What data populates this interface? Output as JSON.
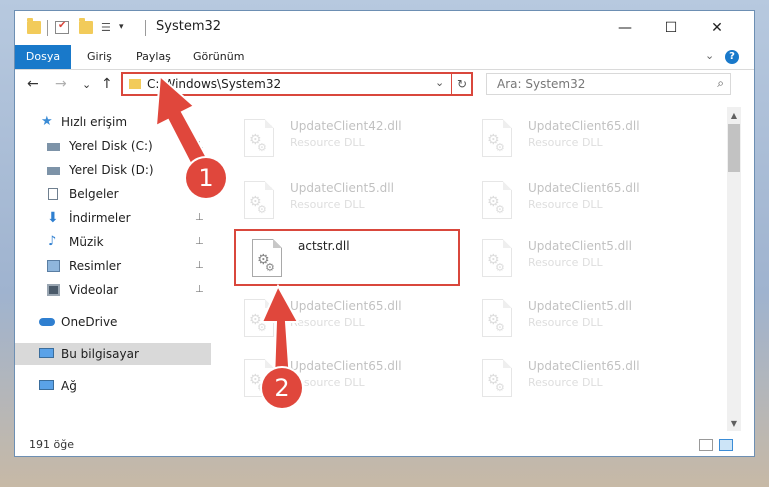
{
  "window": {
    "title": "System32",
    "controls": {
      "minimize": "—",
      "maximize": "☐",
      "close": "✕"
    }
  },
  "ribbon": {
    "tabs": [
      "Dosya",
      "Giriş",
      "Paylaş",
      "Görünüm"
    ],
    "expand_glyph": "⌄",
    "help_glyph": "?"
  },
  "nav": {
    "back": "←",
    "forward": "→",
    "recent": "⌄",
    "up": "↑",
    "address": "C:\\Windows\\System32",
    "address_drop": "⌄",
    "refresh": "↻",
    "search_placeholder": "Ara: System32",
    "search_glyph": "⌕"
  },
  "sidebar": {
    "items": [
      {
        "label": "Hızlı erişim",
        "icon": "star-icon"
      },
      {
        "label": "Yerel Disk (C:)",
        "icon": "drive-icon",
        "pinned": true
      },
      {
        "label": "Yerel Disk (D:)",
        "icon": "drive-icon"
      },
      {
        "label": "Belgeler",
        "icon": "documents-icon"
      },
      {
        "label": "İndirmeler",
        "icon": "download-icon",
        "pinned": true
      },
      {
        "label": "Müzik",
        "icon": "music-icon",
        "pinned": true
      },
      {
        "label": "Resimler",
        "icon": "pictures-icon",
        "pinned": true
      },
      {
        "label": "Videolar",
        "icon": "videos-icon",
        "pinned": true
      },
      {
        "label": "OneDrive",
        "icon": "cloud-icon"
      },
      {
        "label": "Bu bilgisayar",
        "icon": "computer-icon",
        "selected": true
      },
      {
        "label": "Ağ",
        "icon": "network-icon"
      }
    ],
    "pin_glyph": "📌"
  },
  "files": [
    {
      "name": "UpdateClient42.dll",
      "type": "Resource DLL"
    },
    {
      "name": "UpdateClient65.dll",
      "type": "Resource DLL"
    },
    {
      "name": "UpdateClient5.dll",
      "type": "Resource DLL"
    },
    {
      "name": "UpdateClient65.dll",
      "type": "Resource DLL"
    },
    {
      "name": "actstr.dll",
      "type": ""
    },
    {
      "name": "UpdateClient5.dll",
      "type": "Resource DLL"
    },
    {
      "name": "UpdateClient65.dll",
      "type": "Resource DLL"
    },
    {
      "name": "UpdateClient5.dll",
      "type": "Resource DLL"
    },
    {
      "name": "UpdateClient65.dll",
      "type": "Resource DLL"
    },
    {
      "name": "UpdateClient65.dll",
      "type": "Resource DLL"
    }
  ],
  "status": {
    "item_count": "191 öğe"
  },
  "annotations": {
    "step1": "1",
    "step2": "2"
  },
  "colors": {
    "accent": "#1979ca",
    "highlight": "#d9473c",
    "folder": "#f2cb5a"
  }
}
